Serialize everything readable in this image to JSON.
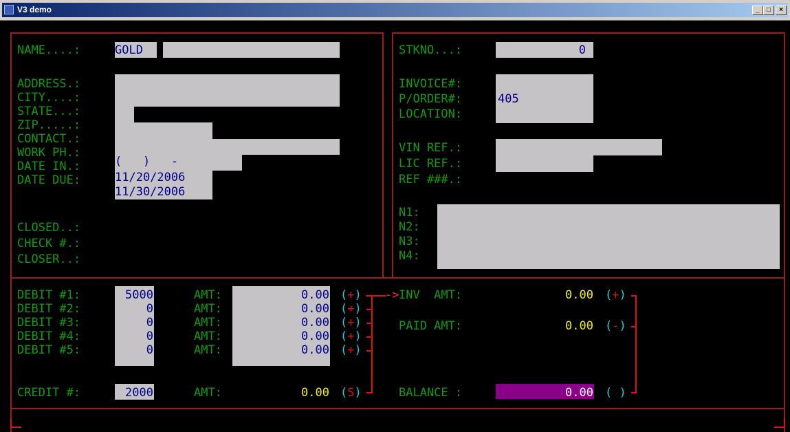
{
  "window": {
    "title": "V3 demo",
    "buttons": {
      "minimize": "_",
      "maximize": "□",
      "close": "×"
    }
  },
  "customer": {
    "name_label": "NAME....:",
    "name_value": "GOLD",
    "address_label": "ADDRESS.:",
    "city_label": "CITY....:",
    "state_label": "STATE...:",
    "zip_label": "ZIP.....:",
    "contact_label": "CONTACT.:",
    "work_phone_label": "WORK PH.:",
    "work_phone_value": "(   )   -",
    "date_in_label": "DATE IN.:",
    "date_in_value": "11/20/2006",
    "date_due_label": "DATE DUE:",
    "date_due_value": "11/30/2006",
    "closed_label": "CLOSED..:",
    "check_label": "CHECK #.:",
    "closer_label": "CLOSER..:"
  },
  "order": {
    "stkno_label": "STKNO...:",
    "stkno_value": "0",
    "invoice_label": "INVOICE#:",
    "porder_label": "P/ORDER#:",
    "porder_value": "405",
    "location_label": "LOCATION:",
    "vin_ref_label": "VIN REF.:",
    "lic_ref_label": "LIC REF.:",
    "ref_label": "REF ###.:",
    "n1_label": "N1:",
    "n2_label": "N2:",
    "n3_label": "N3:",
    "n4_label": "N4:"
  },
  "debits": [
    {
      "label": "DEBIT #1:",
      "code": "5000",
      "amt_label": "AMT:",
      "amount": "0.00",
      "sign": "(+)"
    },
    {
      "label": "DEBIT #2:",
      "code": "0",
      "amt_label": "AMT:",
      "amount": "0.00",
      "sign": "(+)"
    },
    {
      "label": "DEBIT #3:",
      "code": "0",
      "amt_label": "AMT:",
      "amount": "0.00",
      "sign": "(+)"
    },
    {
      "label": "DEBIT #4:",
      "code": "0",
      "amt_label": "AMT:",
      "amount": "0.00",
      "sign": "(+)"
    },
    {
      "label": "DEBIT #5:",
      "code": "0",
      "amt_label": "AMT:",
      "amount": "0.00",
      "sign": "(+)"
    }
  ],
  "credit": {
    "label": "CREDIT #:",
    "code": "2000",
    "amt_label": "AMT:",
    "amount": "0.00",
    "sign": "(S)"
  },
  "totals": {
    "arrow": "->",
    "inv_label": "INV  AMT:",
    "inv_value": "0.00",
    "inv_sign": "(+)",
    "paid_label": "PAID AMT:",
    "paid_value": "0.00",
    "paid_sign": "(-)",
    "balance_label": "BALANCE :",
    "balance_value": "0.00",
    "balance_sign": "( )"
  },
  "colors": {
    "background": "#000000",
    "label_green": "#0e9b0e",
    "field_grey": "#c6c3c6",
    "value_navy": "#00008b",
    "amount_yellow": "#f4f000",
    "sign_cyan": "#17d0d8",
    "border_red": "#9c1b1b",
    "bracket_red": "#e01010",
    "balance_magenta": "#8b008b"
  }
}
